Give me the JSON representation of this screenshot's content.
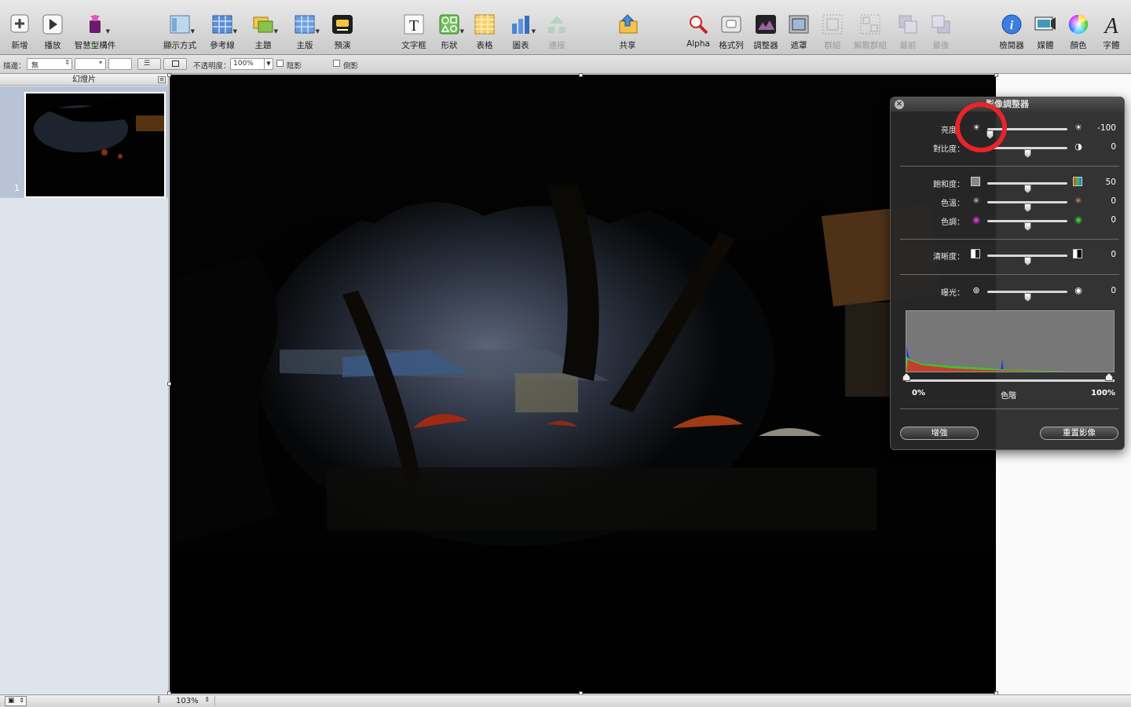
{
  "toolbar": {
    "left": [
      {
        "id": "new",
        "label": "新增",
        "icon": "plus-icon"
      },
      {
        "id": "play",
        "label": "播放",
        "icon": "play-icon"
      },
      {
        "id": "smart",
        "label": "智慧型構件",
        "icon": "smart-build-icon"
      },
      {
        "id": "view",
        "label": "顯示方式",
        "icon": "view-icon"
      },
      {
        "id": "guides",
        "label": "參考線",
        "icon": "guides-icon"
      },
      {
        "id": "themes",
        "label": "主題",
        "icon": "themes-icon"
      },
      {
        "id": "masters",
        "label": "主版",
        "icon": "masters-icon"
      },
      {
        "id": "rehearse",
        "label": "預演",
        "icon": "rehearse-icon"
      }
    ],
    "middle": [
      {
        "id": "textbox",
        "label": "文字框",
        "icon": "text-box-icon"
      },
      {
        "id": "shapes",
        "label": "形狀",
        "icon": "shapes-icon"
      },
      {
        "id": "table",
        "label": "表格",
        "icon": "table-icon"
      },
      {
        "id": "charts",
        "label": "圖表",
        "icon": "chart-icon"
      },
      {
        "id": "connect",
        "label": "連接",
        "icon": "connect-icon"
      },
      {
        "id": "share",
        "label": "共享",
        "icon": "share-icon"
      }
    ],
    "right": [
      {
        "id": "alpha",
        "label": "Alpha",
        "icon": "alpha-icon"
      },
      {
        "id": "formatbar",
        "label": "格式列",
        "icon": "format-bar-icon"
      },
      {
        "id": "adjust",
        "label": "調整器",
        "icon": "adjust-icon"
      },
      {
        "id": "mask",
        "label": "遮罩",
        "icon": "mask-icon"
      },
      {
        "id": "group",
        "label": "群組",
        "icon": "group-icon"
      },
      {
        "id": "ungroup",
        "label": "解散群組",
        "icon": "ungroup-icon"
      },
      {
        "id": "front",
        "label": "最前",
        "icon": "front-icon"
      },
      {
        "id": "back",
        "label": "最後",
        "icon": "back-icon"
      },
      {
        "id": "inspector",
        "label": "檢閱器",
        "icon": "inspector-icon"
      },
      {
        "id": "media",
        "label": "媒體",
        "icon": "media-icon"
      },
      {
        "id": "colors",
        "label": "顏色",
        "icon": "colors-icon"
      },
      {
        "id": "fonts",
        "label": "字體",
        "icon": "fonts-icon"
      }
    ]
  },
  "formatbar": {
    "stroke_label": "描邊：",
    "stroke_value": "無",
    "opacity_label": "不透明度：",
    "opacity_value": "100%",
    "shadow_label": "陰影",
    "reflection_label": "倒影"
  },
  "slides_pane": {
    "title": "幻燈片",
    "slides": [
      {
        "number": "1"
      }
    ]
  },
  "bottombar": {
    "zoom": "103%"
  },
  "adjust_panel": {
    "title": "影像調整器",
    "rows": [
      {
        "label": "亮度：",
        "value": "-100",
        "fraction": 0.0
      },
      {
        "label": "對比度：",
        "value": "0",
        "fraction": 0.5
      },
      {
        "label": "飽和度：",
        "value": "50",
        "fraction": 0.5
      },
      {
        "label": "色溫：",
        "value": "0",
        "fraction": 0.5
      },
      {
        "label": "色調：",
        "value": "0",
        "fraction": 0.5
      },
      {
        "label": "清晰度：",
        "value": "0",
        "fraction": 0.5
      },
      {
        "label": "曝光：",
        "value": "0",
        "fraction": 0.5
      }
    ],
    "levels_min": "0%",
    "levels_label": "色階",
    "levels_max": "100%",
    "enhance_label": "增強",
    "reset_label": "重置影像"
  },
  "colors": {
    "highlight_circle": "#e8242a",
    "panel_bg": "#282828"
  }
}
